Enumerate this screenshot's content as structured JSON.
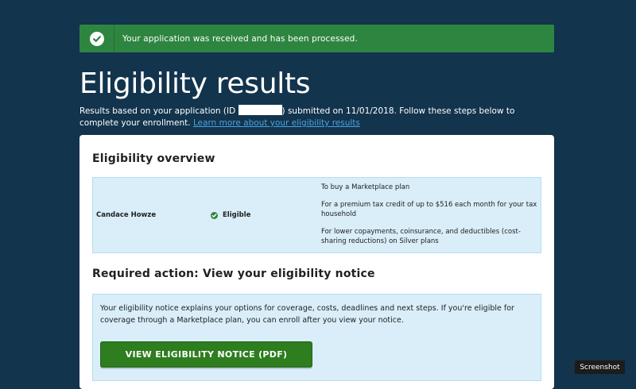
{
  "alert": {
    "message": "Your application was received and has been processed.",
    "icon": "check-circle-icon",
    "color": "#2e8540"
  },
  "header": {
    "title": "Eligibility results",
    "intro_before_id": "Results based on your application (ID ",
    "intro_after_id": ") submitted on 11/01/2018. Follow these steps below to complete your enrollment. ",
    "learn_more_link": "Learn more about your eligibility results"
  },
  "overview": {
    "title": "Eligibility overview",
    "rows": [
      {
        "name": "Candace Howze",
        "status": "Eligible",
        "reasons": [
          "To buy a Marketplace plan",
          "For a premium tax credit of up to $516 each month for your tax household",
          "For lower copayments, coinsurance, and deductibles (cost-sharing reductions) on Silver plans"
        ]
      }
    ]
  },
  "required_action": {
    "title": "Required action: View your eligibility notice",
    "description": "Your eligibility notice explains your options for coverage, costs, deadlines and next steps. If you're eligible for coverage through a Marketplace plan, you can enroll after you view your notice.",
    "button_label": "VIEW ELIGIBILITY NOTICE (PDF)"
  },
  "overlay": {
    "screenshot_label": "Screenshot"
  },
  "colors": {
    "background": "#12344d",
    "success_green": "#2e8540",
    "panel_blue": "#d9eef9",
    "link_blue": "#4aa3df"
  }
}
